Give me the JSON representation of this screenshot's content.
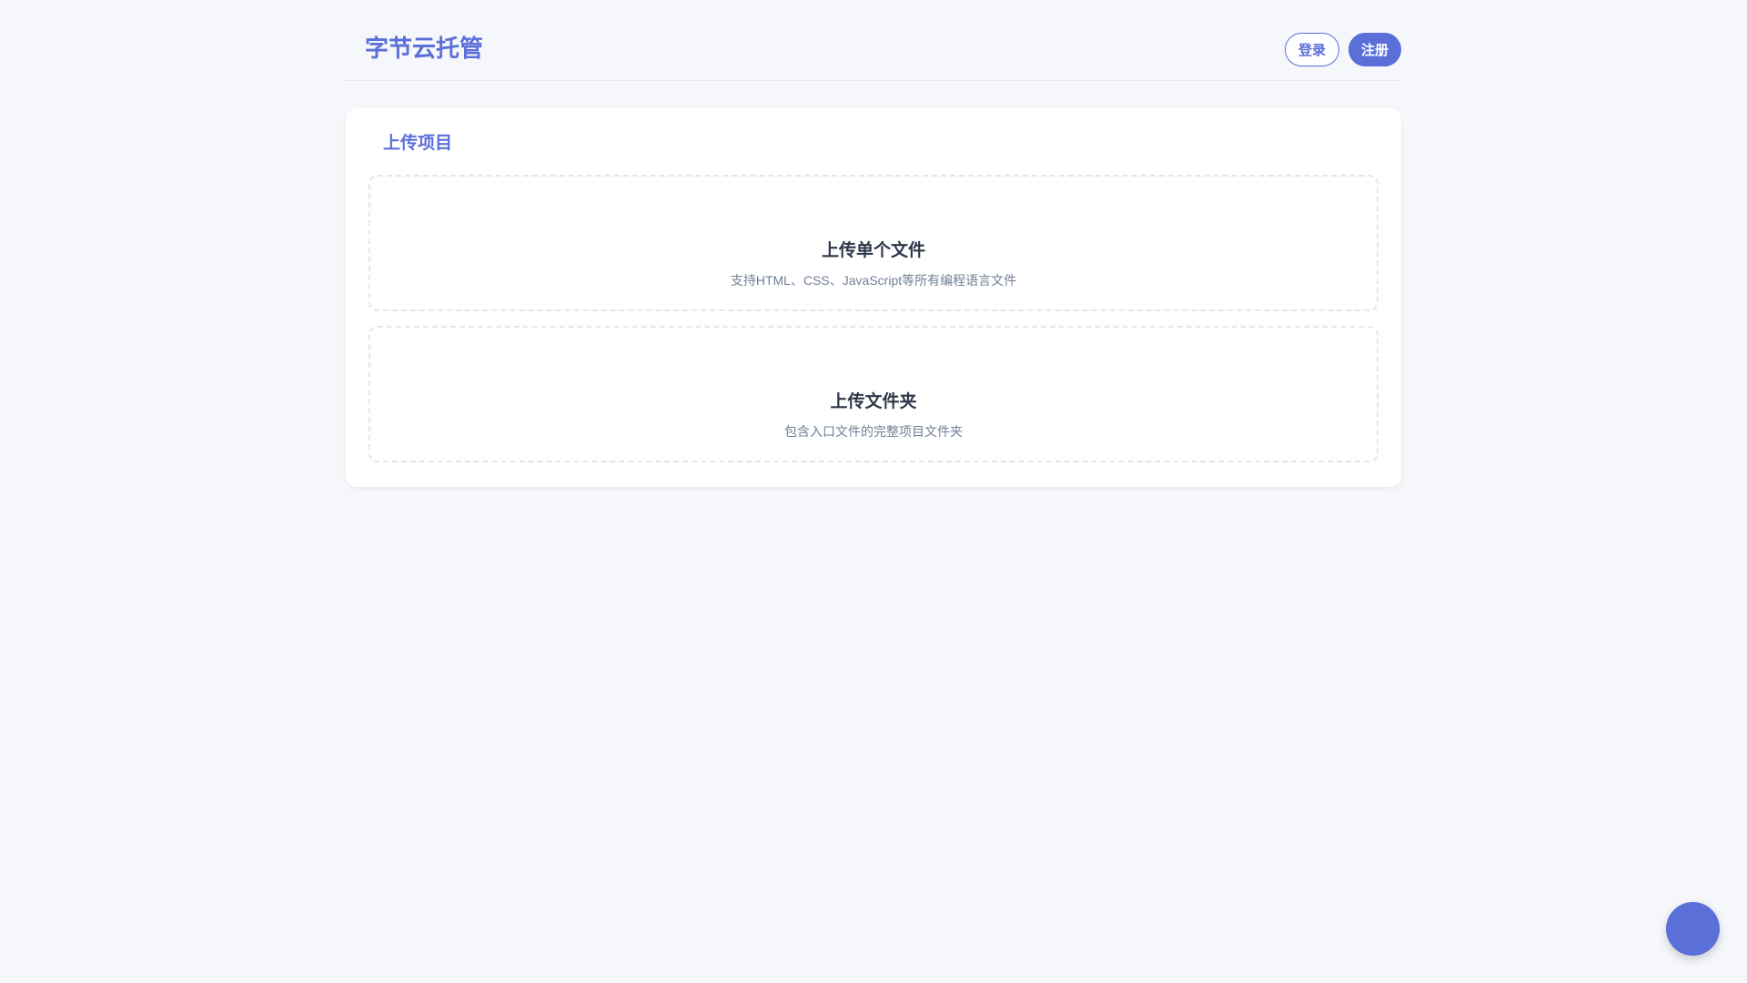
{
  "header": {
    "logo": "字节云托管",
    "login_label": "登录",
    "register_label": "注册"
  },
  "upload": {
    "title": "上传项目",
    "file": {
      "title": "上传单个文件",
      "description": "支持HTML、CSS、JavaScript等所有编程语言文件"
    },
    "folder": {
      "title": "上传文件夹",
      "description": "包含入口文件的完整项目文件夹"
    }
  },
  "colors": {
    "accent": "#5b6fd9",
    "background": "#f5f7fa",
    "card": "#ffffff",
    "text": "#2d3748",
    "muted": "#718096"
  }
}
